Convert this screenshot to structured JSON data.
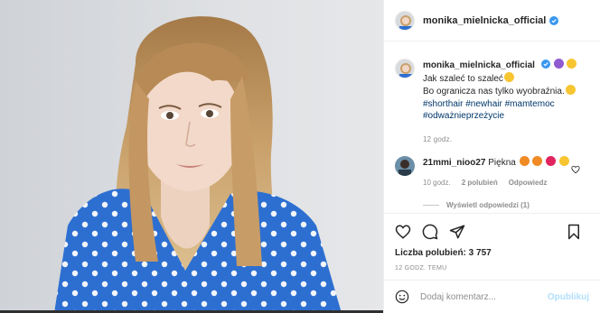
{
  "post": {
    "photo_alt": "photo",
    "colors": {
      "background": "#d9dbdf",
      "hair": "#c79a5e",
      "shirt": "#2d6fd1"
    }
  },
  "header": {
    "username": "monika_mielnicka_official",
    "verified": true
  },
  "caption": {
    "username": "monika_mielnicka_official",
    "line1": "Jak szaleć to szaleć",
    "line2": "Bo ogranicza nas tylko wyobraźnia.",
    "hashtags_line1": [
      "#shorthair",
      "#newhair",
      "#mamtemoc"
    ],
    "hashtags_line2": [
      "#odważnieprzeżycie"
    ],
    "time": "12 godz."
  },
  "comment": {
    "username": "21mmi_nioo27",
    "text": "Piękna",
    "time": "10 godz.",
    "likes": "2 polubień",
    "reply_label": "Odpowiedz",
    "view_replies": "Wyświetl odpowiedzi (1)"
  },
  "actions": {
    "icons": [
      "heart-icon",
      "comment-icon",
      "share-icon",
      "bookmark-icon"
    ],
    "likes_label": "Liczba polubień: 3 757",
    "post_time": "12 GODZ. TEMU"
  },
  "add_comment": {
    "placeholder": "Dodaj komentarz...",
    "publish_label": "Opublikuj",
    "colors": {
      "link": "#00376b",
      "publish_disabled": "#b2dffc",
      "verified": "#3897f0"
    }
  }
}
